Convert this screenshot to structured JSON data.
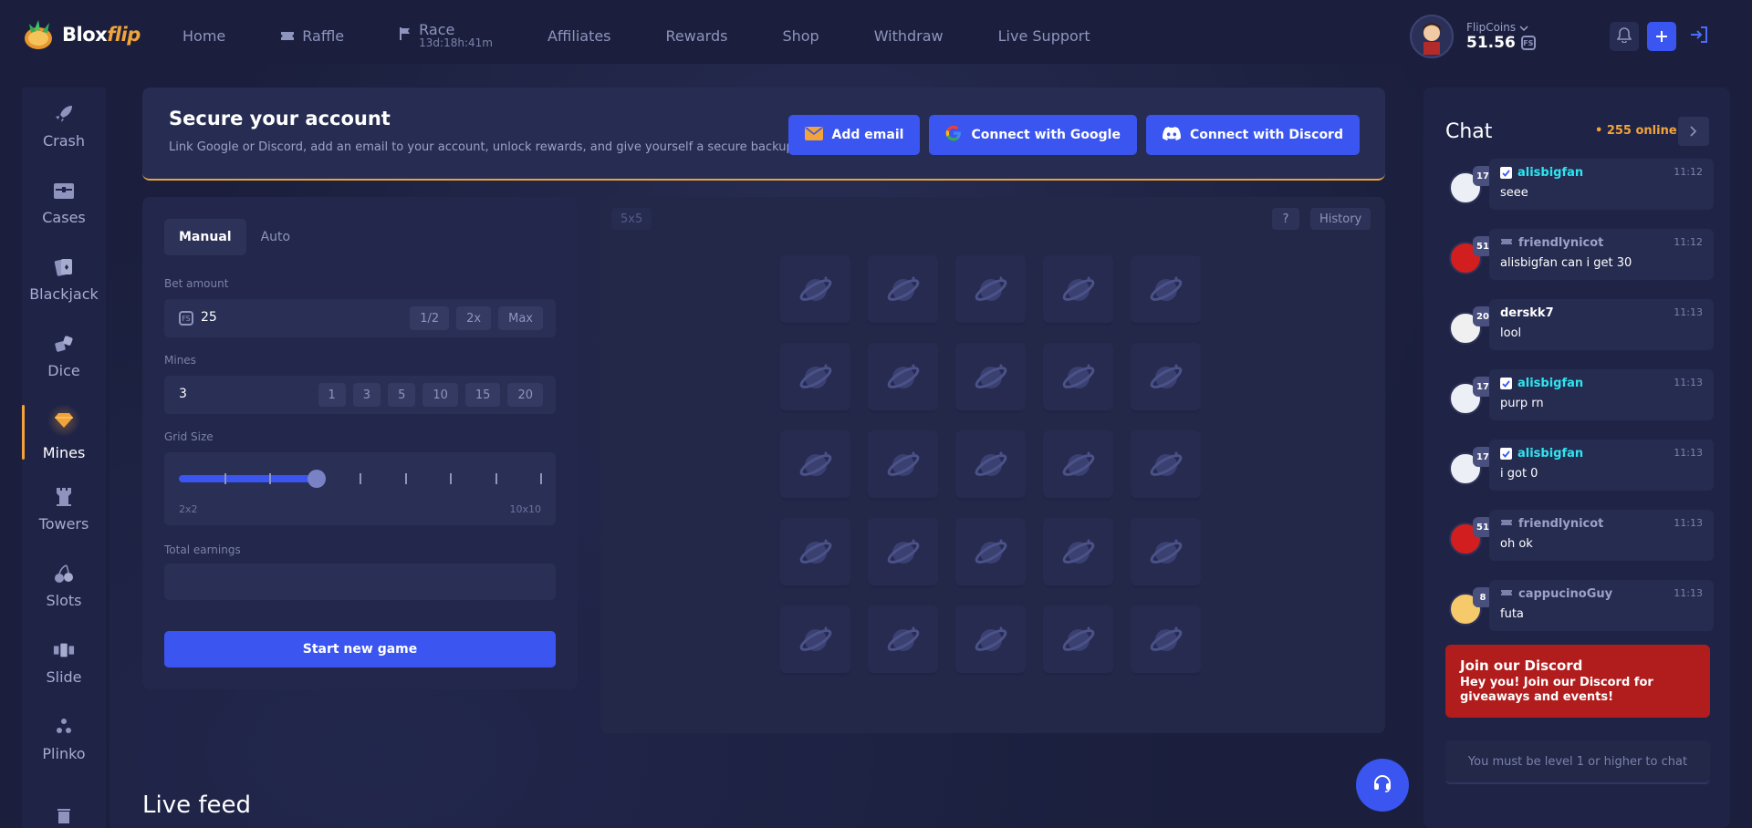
{
  "brand": {
    "name_main": "Blox",
    "name_accent": "flip"
  },
  "nav": {
    "home": "Home",
    "raffle": "Raffle",
    "race": "Race",
    "race_timer": "13d:18h:41m",
    "affiliates": "Affiliates",
    "rewards": "Rewards",
    "shop": "Shop",
    "withdraw": "Withdraw",
    "live_support": "Live Support"
  },
  "wallet": {
    "label": "FlipCoins",
    "balance": "51.56",
    "coin_symbol": "FS"
  },
  "sidebar": {
    "items": [
      {
        "label": "Crash",
        "icon": "rocket-icon"
      },
      {
        "label": "Cases",
        "icon": "cases-icon"
      },
      {
        "label": "Blackjack",
        "icon": "cards-icon"
      },
      {
        "label": "Dice",
        "icon": "dice-icon"
      },
      {
        "label": "Mines",
        "icon": "gem-icon",
        "active": true
      },
      {
        "label": "Towers",
        "icon": "tower-icon"
      },
      {
        "label": "Slots",
        "icon": "cherry-icon"
      },
      {
        "label": "Slide",
        "icon": "slide-icon"
      },
      {
        "label": "Plinko",
        "icon": "plinko-icon"
      }
    ]
  },
  "banner": {
    "title": "Secure your account",
    "subtitle": "Link Google or Discord, add an email to your account, unlock rewards, and give yourself a secure backup login.",
    "add_email": "Add email",
    "google": "Connect with Google",
    "discord": "Connect with Discord"
  },
  "bet": {
    "tab_manual": "Manual",
    "tab_auto": "Auto",
    "bet_label": "Bet amount",
    "bet_value": "25",
    "half": "1/2",
    "double": "2x",
    "max": "Max",
    "mines_label": "Mines",
    "mines_value": "3",
    "mines_options": [
      "1",
      "3",
      "5",
      "10",
      "15",
      "20"
    ],
    "grid_label": "Grid Size",
    "grid_min": "2x2",
    "grid_max": "10x10",
    "grid_level": 0.33,
    "earnings_label": "Total earnings",
    "start": "Start new game"
  },
  "board": {
    "size": "5x5",
    "help": "?",
    "history": "History",
    "rows": 5,
    "cols": 5
  },
  "live_feed": "Live feed",
  "chat": {
    "title": "Chat",
    "online": "• 255 online",
    "messages": [
      {
        "user": "alisbigfan",
        "level": "17",
        "time": "11:12",
        "text": "seee",
        "color": "#2ee6f0",
        "verified": true
      },
      {
        "user": "friendlynicot",
        "level": "51",
        "time": "11:12",
        "text": "alisbigfan can i get 30",
        "color": "#9ba1c8",
        "verified": false
      },
      {
        "user": "derskk7",
        "level": "20",
        "time": "11:13",
        "text": "lool",
        "color": "#ffffff",
        "verified": false
      },
      {
        "user": "alisbigfan",
        "level": "17",
        "time": "11:13",
        "text": "purp rn",
        "color": "#2ee6f0",
        "verified": true
      },
      {
        "user": "alisbigfan",
        "level": "17",
        "time": "11:13",
        "text": "i got 0",
        "color": "#2ee6f0",
        "verified": true
      },
      {
        "user": "friendlynicot",
        "level": "51",
        "time": "11:13",
        "text": "oh ok",
        "color": "#9ba1c8",
        "verified": false
      },
      {
        "user": "cappucinoGuy",
        "level": "8",
        "time": "11:13",
        "text": "futa",
        "color": "#9ba1c8",
        "verified": false
      }
    ],
    "discord_title": "Join our Discord",
    "discord_text": "Hey you! Join our Discord for giveaways and events!",
    "input_placeholder": "You must be level 1 or higher to chat"
  },
  "colors": {
    "accent": "#3a55f0",
    "brand_orange": "#f2a33a",
    "discord_red": "#b11c1c"
  }
}
